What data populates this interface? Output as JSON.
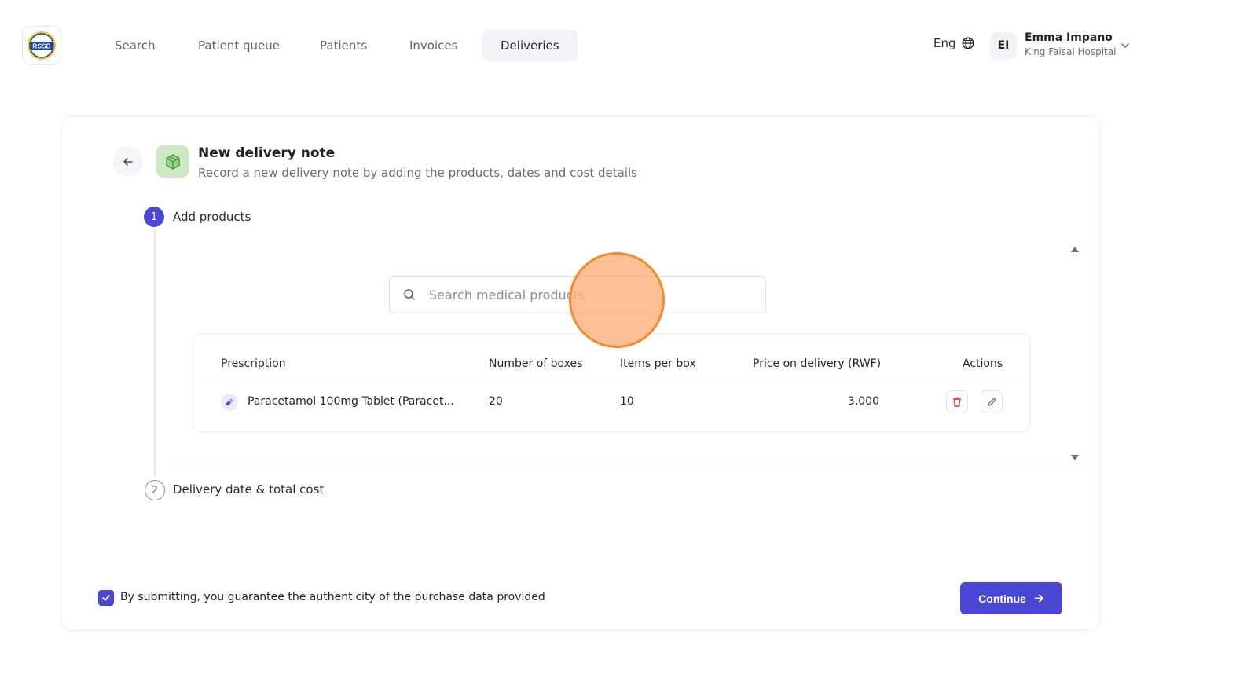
{
  "nav": {
    "logo_icon": "rssb-logo",
    "items": [
      {
        "label": "Search"
      },
      {
        "label": "Patient queue"
      },
      {
        "label": "Patients"
      },
      {
        "label": "Invoices"
      },
      {
        "label": "Deliveries",
        "active": true
      }
    ],
    "language": "Eng",
    "language_icon": "globe-icon",
    "user": {
      "initials": "EI",
      "name": "Emma Impano",
      "organization": "King Faisal Hospital"
    }
  },
  "page": {
    "title": "New delivery note",
    "subtitle": "Record a new delivery note by adding the products, dates and cost details",
    "icon": "box-icon"
  },
  "steps": [
    {
      "number": "1",
      "label": "Add products",
      "active": true
    },
    {
      "number": "2",
      "label": "Delivery date & total cost",
      "active": false
    }
  ],
  "search": {
    "placeholder": "Search medical products"
  },
  "table": {
    "headers": [
      "Prescription",
      "Number of boxes",
      "Items per box",
      "Price on delivery (RWF)",
      "Actions"
    ],
    "rows": [
      {
        "prescription": "Paracetamol 100mg Tablet (Paracet...",
        "boxes": "20",
        "items_per_box": "10",
        "price": "3,000"
      }
    ]
  },
  "footer": {
    "consent_checked": true,
    "consent_label": "By submitting, you guarantee the authenticity of the purchase data provided",
    "continue_label": "Continue"
  },
  "colors": {
    "accent": "#4a47d6",
    "delete": "#d63a3a",
    "box_icon_bg": "#cde9c3",
    "click_marker": "#f08a34"
  }
}
